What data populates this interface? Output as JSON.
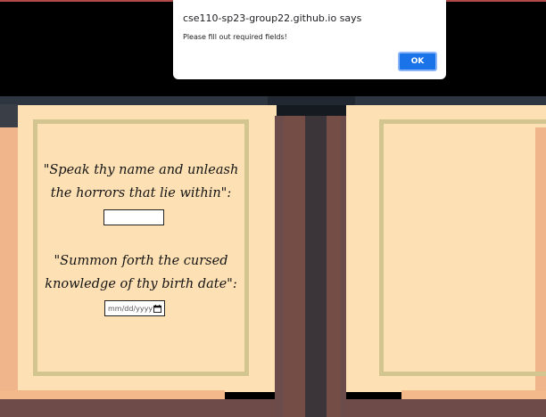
{
  "dialog": {
    "title": "cse110-sp23-group22.github.io says",
    "message": "Please fill out required fields!",
    "ok_label": "OK"
  },
  "form": {
    "name_prompt": "\"Speak thy name and unleash the horrors that lie within\":",
    "name_value": "",
    "birth_prompt": "\"Summon forth the cursed knowledge of thy birth date\":",
    "birth_placeholder": "mm/dd/yyyy"
  },
  "colors": {
    "page": "#fde0b4",
    "frame": "#d2c590",
    "cover": "#6e4a48",
    "dialog_button": "#1a73e8"
  },
  "icons": {
    "date_picker": "calendar-icon"
  }
}
